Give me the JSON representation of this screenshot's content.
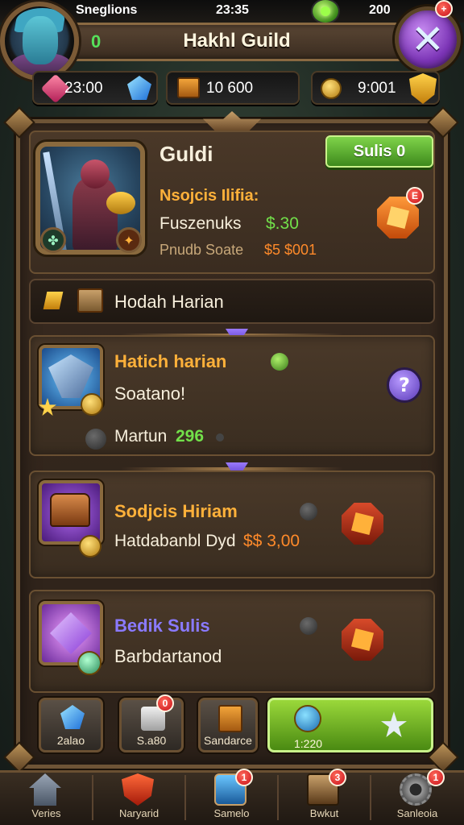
{
  "status": {
    "left": "Sneglions",
    "time": "23:35",
    "right": "200"
  },
  "header": {
    "title": "Hakhl Guild",
    "count": "0",
    "close_badge": "+"
  },
  "currencies": [
    {
      "icon": "pink-gem-icon",
      "value": "23:00"
    },
    {
      "icon": "crate-icon",
      "value": "10 600"
    },
    {
      "icon": "coin-icon",
      "value": "9:001"
    }
  ],
  "guild": {
    "title": "Guldi",
    "action_label": "Sulis 0",
    "line1": "Nsojcis Ilifia:",
    "line2_label": "Fuszenuks",
    "line2_value": "$.30",
    "line3_label": "Pnudb Soate",
    "line3_value": "$5 $001",
    "badge": "E"
  },
  "section": {
    "label": "Hodah Harian"
  },
  "cards": [
    {
      "title": "Hatich harian",
      "subtitle": "Soatano!",
      "footer_label": "Martun",
      "footer_value": "296",
      "action": "?"
    },
    {
      "title": "Sodjcis Hiriam",
      "subtitle": "Hatdabanbl Dyd",
      "subtitle_value": "$$ 3,00"
    },
    {
      "title": "Bedik Sulis",
      "subtitle": "Barbdartanod"
    }
  ],
  "slots": [
    {
      "label": "2alao"
    },
    {
      "label": "S.a80",
      "badge": "0"
    },
    {
      "label": "Sandarce"
    },
    {
      "label": "1:220"
    }
  ],
  "nav": [
    {
      "label": "Veries",
      "icon": "home-icon"
    },
    {
      "label": "Naryarid",
      "icon": "guild-shield-icon",
      "badge": ""
    },
    {
      "label": "Samelo",
      "icon": "map-icon",
      "badge": "1"
    },
    {
      "label": "Bwkut",
      "icon": "book-icon",
      "badge": "3"
    },
    {
      "label": "Sanleoia",
      "icon": "gear-icon",
      "badge": "1"
    }
  ],
  "colors": {
    "panel": "#3a2b20",
    "frame": "#6e5436",
    "accent_green": "#72e04a",
    "accent_gold": "#ffb13a",
    "accent_purple": "#8a7aff"
  }
}
